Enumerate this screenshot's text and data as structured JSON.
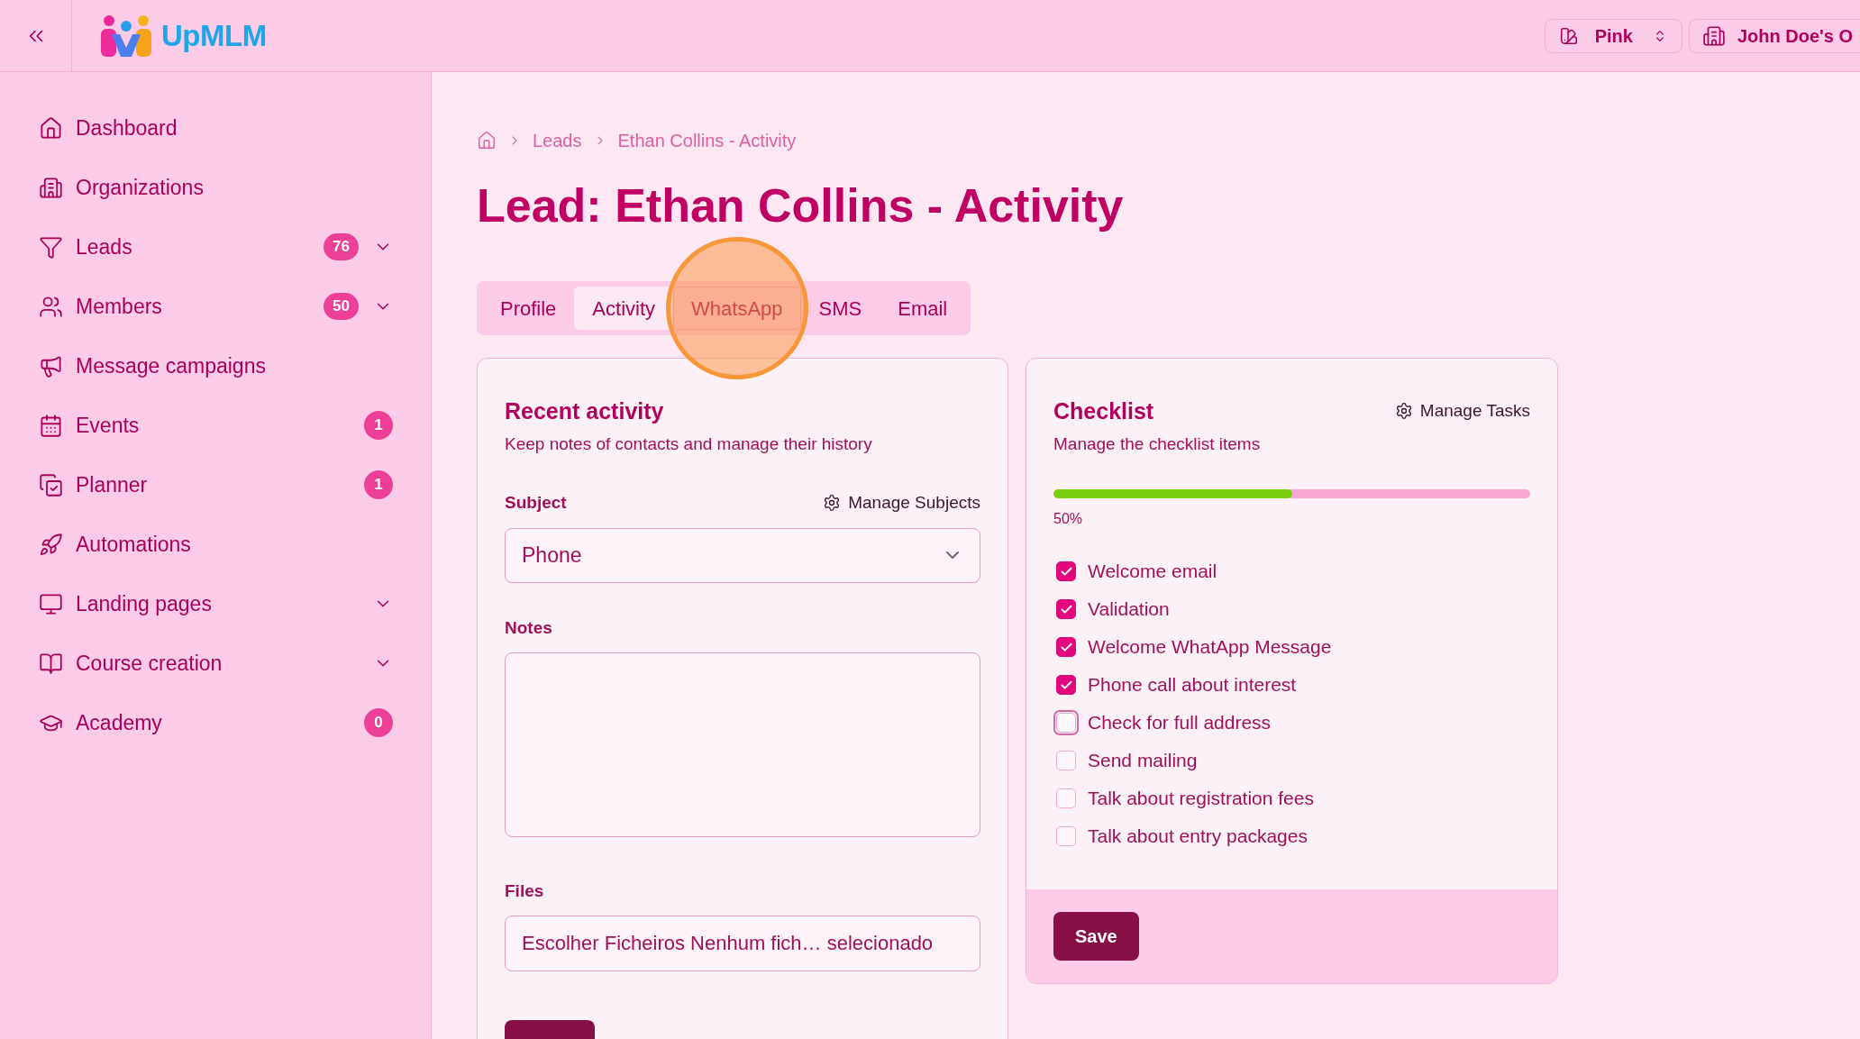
{
  "header": {
    "logo_text": "UpMLM",
    "theme_selector": {
      "value": "Pink"
    },
    "organization_selector": {
      "value": "John Doe's O"
    }
  },
  "sidebar": {
    "items": [
      {
        "label": "Dashboard",
        "kind": "link"
      },
      {
        "label": "Organizations",
        "kind": "link"
      },
      {
        "label": "Leads",
        "kind": "group",
        "badge": "76",
        "expanded": false
      },
      {
        "label": "Members",
        "kind": "group",
        "badge": "50",
        "expanded": false
      },
      {
        "label": "Message campaigns",
        "kind": "link"
      },
      {
        "label": "Events",
        "kind": "link",
        "badge": "1"
      },
      {
        "label": "Planner",
        "kind": "link",
        "badge": "1"
      },
      {
        "label": "Automations",
        "kind": "link"
      },
      {
        "label": "Landing pages",
        "kind": "group",
        "expanded": false
      },
      {
        "label": "Course creation",
        "kind": "group",
        "expanded": false
      },
      {
        "label": "Academy",
        "kind": "link",
        "badge": "0"
      }
    ]
  },
  "breadcrumb": [
    "Leads",
    "Ethan Collins - Activity"
  ],
  "page_title": "Lead: Ethan Collins - Activity",
  "tabs": [
    {
      "label": "Profile",
      "selected": false,
      "clicked": false
    },
    {
      "label": "Activity",
      "selected": true,
      "clicked": false
    },
    {
      "label": "WhatsApp",
      "selected": false,
      "clicked": true
    },
    {
      "label": "SMS",
      "selected": false,
      "clicked": false
    },
    {
      "label": "Email",
      "selected": false,
      "clicked": false
    }
  ],
  "activity_card": {
    "title": "Recent activity",
    "subtitle": "Keep notes of contacts and manage their history",
    "subject": {
      "label": "Subject",
      "manage_link": "Manage Subjects",
      "value": "Phone"
    },
    "notes": {
      "label": "Notes"
    },
    "files": {
      "label": "Files",
      "button_label": "Escolher Ficheiros",
      "status": "Nenhum fich… selecionado"
    }
  },
  "checklist_card": {
    "title": "Checklist",
    "subtitle": "Manage the checklist items",
    "manage_link": "Manage Tasks",
    "progress": {
      "level": 0.5,
      "reading": "50%"
    },
    "items": [
      {
        "label": "Welcome email",
        "checked": true,
        "focused": false
      },
      {
        "label": "Validation",
        "checked": true,
        "focused": false
      },
      {
        "label": "Welcome WhatApp Message",
        "checked": true,
        "focused": false
      },
      {
        "label": "Phone call about interest",
        "checked": true,
        "focused": false
      },
      {
        "label": "Check for full address",
        "checked": false,
        "focused": true
      },
      {
        "label": "Send mailing",
        "checked": false,
        "focused": false
      },
      {
        "label": "Talk about registration fees",
        "checked": false,
        "focused": false
      },
      {
        "label": "Talk about entry packages",
        "checked": false,
        "focused": false
      }
    ],
    "save_button": "Save"
  }
}
